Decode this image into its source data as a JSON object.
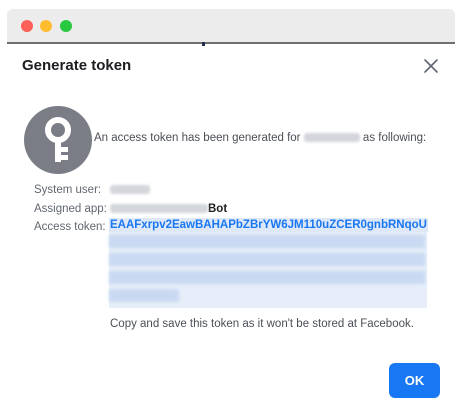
{
  "window": {
    "controls": [
      "close-dot",
      "minimize-dot",
      "zoom-dot"
    ],
    "colors": {
      "close": "#fe5f57",
      "minimize": "#febc2e",
      "zoom": "#28c840"
    }
  },
  "dialog": {
    "title": "Generate token",
    "close_icon": "close-icon",
    "key_icon": "key-icon",
    "intro_prefix": "An access token has been generated for",
    "intro_suffix": "as following:",
    "system_user_label": "System user:",
    "assigned_app_label": "Assigned app:",
    "assigned_app_suffix": "Bot",
    "access_token_label": "Access token:",
    "access_token_visible": "EAAFxrpv2EawBAHAPbZBrYW6JM110uZCER0gnbRNqoU",
    "copy_note": "Copy and save this token as it won't be stored at Facebook.",
    "ok_label": "OK",
    "accent_color": "#1877f2"
  }
}
